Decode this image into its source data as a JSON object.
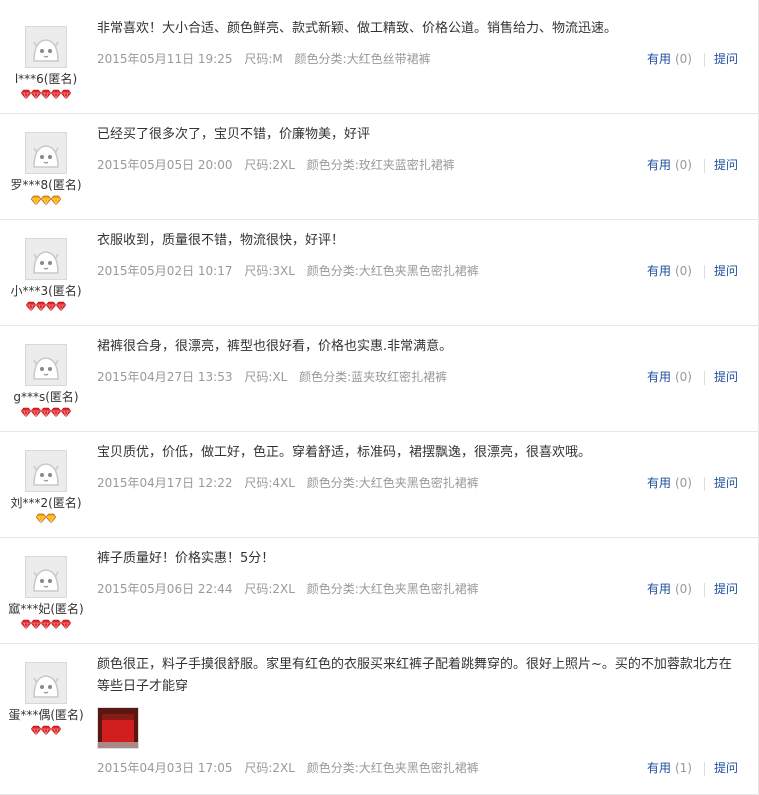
{
  "reviews": [
    {
      "username": "l***6(匿名)",
      "rank": "red",
      "rank_count": 5,
      "content": "非常喜欢！大小合适、颜色鲜亮、款式新颖、做工精致、价格公道。销售给力、物流迅速。",
      "date": "2015年05月11日 19:25",
      "size": "尺码:M",
      "color": "颜色分类:大红色丝带裙裤",
      "useful_label": "有用",
      "useful_count": "(0)",
      "reply_label": "提问"
    },
    {
      "username": "罗***8(匿名)",
      "rank": "gold",
      "rank_count": 3,
      "content": "已经买了很多次了，宝贝不错，价廉物美，好评",
      "date": "2015年05月05日 20:00",
      "size": "尺码:2XL",
      "color": "颜色分类:玫红夹蓝密扎裙裤",
      "useful_label": "有用",
      "useful_count": "(0)",
      "reply_label": "提问"
    },
    {
      "username": "小***3(匿名)",
      "rank": "red",
      "rank_count": 4,
      "content": "衣服收到，质量很不错，物流很快，好评！",
      "date": "2015年05月02日 10:17",
      "size": "尺码:3XL",
      "color": "颜色分类:大红色夹黑色密扎裙裤",
      "useful_label": "有用",
      "useful_count": "(0)",
      "reply_label": "提问"
    },
    {
      "username": "g***s(匿名)",
      "rank": "red",
      "rank_count": 5,
      "content": "裙裤很合身，很漂亮，裤型也很好看，价格也实惠.非常满意。",
      "date": "2015年04月27日 13:53",
      "size": "尺码:XL",
      "color": "颜色分类:蓝夹玫红密扎裙裤",
      "useful_label": "有用",
      "useful_count": "(0)",
      "reply_label": "提问"
    },
    {
      "username": "刘***2(匿名)",
      "rank": "gold",
      "rank_count": 2,
      "content": "宝贝质优，价低，做工好，色正。穿着舒适，标准码，裙摆飘逸，很漂亮，很喜欢哦。",
      "date": "2015年04月17日 12:22",
      "size": "尺码:4XL",
      "color": "颜色分类:大红色夹黑色密扎裙裤",
      "useful_label": "有用",
      "useful_count": "(0)",
      "reply_label": "提问"
    },
    {
      "username": "寙***妃(匿名)",
      "rank": "red",
      "rank_count": 5,
      "content": "裤子质量好！价格实惠！5分！",
      "date": "2015年05月06日 22:44",
      "size": "尺码:2XL",
      "color": "颜色分类:大红色夹黑色密扎裙裤",
      "useful_label": "有用",
      "useful_count": "(0)",
      "reply_label": "提问"
    },
    {
      "username": "蛋***偶(匿名)",
      "rank": "red",
      "rank_count": 3,
      "content": "颜色很正，料子手摸很舒服。家里有红色的衣服买来红裤子配着跳舞穿的。很好上照片~。买的不加蓉款北方在等些日子才能穿",
      "date": "2015年04月03日 17:05",
      "size": "尺码:2XL",
      "color": "颜色分类:大红色夹黑色密扎裙裤",
      "useful_label": "有用",
      "useful_count": "(1)",
      "reply_label": "提问",
      "has_photo": true
    }
  ],
  "colors": {
    "link": "#1c4f9c",
    "meta": "#999999",
    "rank_red": "#e0262b",
    "rank_gold": "#f0b400"
  }
}
